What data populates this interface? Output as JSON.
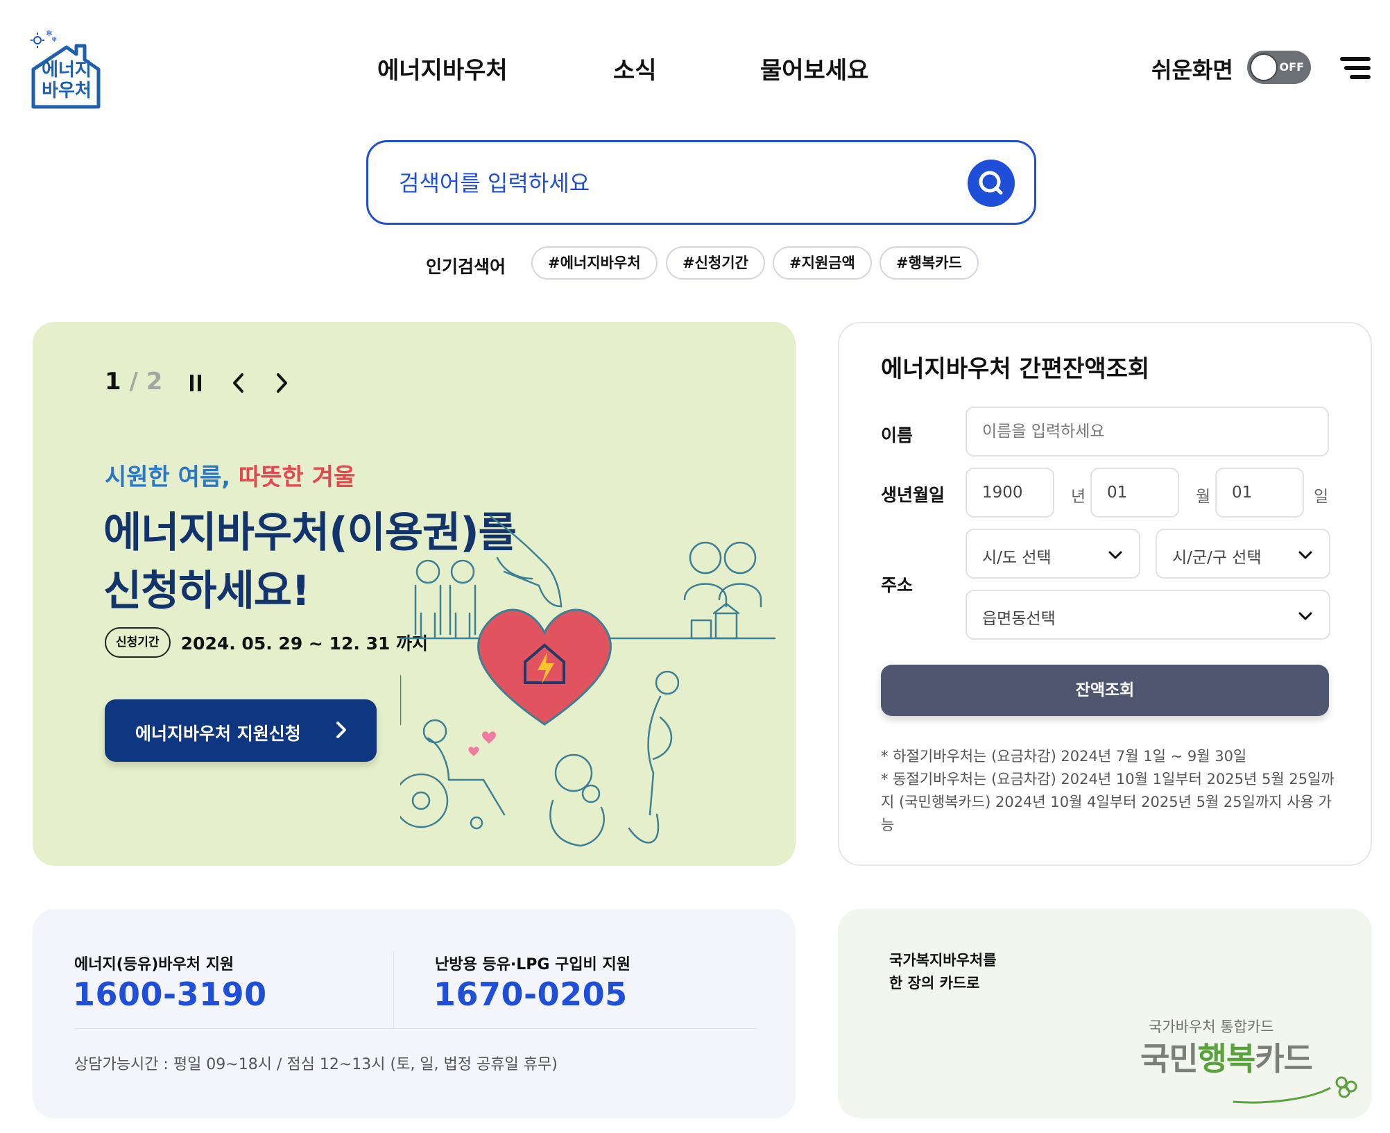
{
  "header": {
    "logo_text_line1": "에너지",
    "logo_text_line2": "바우처",
    "nav": [
      "에너지바우처",
      "소식",
      "물어보세요"
    ],
    "easy_screen_label": "쉬운화면",
    "toggle_state": "OFF",
    "menu_icon": "hamburger-menu-icon"
  },
  "search": {
    "placeholder": "검색어를 입력하세요",
    "button_icon": "search-icon",
    "popular_label": "인기검색어",
    "popular_tags": [
      "#에너지바우처",
      "#신청기간",
      "#지원금액",
      "#행복카드"
    ]
  },
  "banner": {
    "page_current": "1",
    "page_separator": "/",
    "page_total": "2",
    "subtitle_a": "시원한 여름,",
    "subtitle_b": "따뜻한 겨울",
    "headline_line1": "에너지바우처(이용권)를",
    "headline_line2": "신청하세요!",
    "period_badge": "신청기간",
    "period_text": "2024. 05. 29 ~ 12. 31 까지",
    "apply_button": "에너지바우처 지원신청",
    "controls": [
      "pause-icon",
      "chevron-left-icon",
      "chevron-right-icon"
    ],
    "background_color": "#e6efcb"
  },
  "balance": {
    "title": "에너지바우처 간편잔액조회",
    "name_label": "이름",
    "name_placeholder": "이름을 입력하세요",
    "birth_label": "생년월일",
    "birth_year": "1900",
    "birth_year_unit": "년",
    "birth_month": "01",
    "birth_month_unit": "월",
    "birth_day": "01",
    "birth_day_unit": "일",
    "address_label": "주소",
    "sido_select": "시/도 선택",
    "sigungu_select": "시/군/구 선택",
    "eup_select": "읍면동선택",
    "submit_button": "잔액조회",
    "note1": "* 하절기바우처는 (요금차감) 2024년 7월 1일 ~ 9월 30일",
    "note2": "* 동절기바우처는 (요금차감) 2024년 10월 1일부터 2025년 5월 25일까지 (국민행복카드) 2024년 10월 4일부터 2025년 5월 25일까지 사용 가능"
  },
  "contact": {
    "label1": "에너지(등유)바우처 지원",
    "number1": "1600-3190",
    "label2": "난방용 등유·LPG 구입비 지원",
    "number2": "1670-0205",
    "hours": "상담가능시간 : 평일 09~18시 / 점심 12~13시 (토, 일, 법정 공휴일 휴무)"
  },
  "card": {
    "text_line1": "국가복지바우처를",
    "text_line2": "한 장의 카드로",
    "sub": "국가바우처 통합카드",
    "logo_a": "국민",
    "logo_b": "행복",
    "logo_c": "카드"
  },
  "colors": {
    "accent_blue": "#1f4fd8",
    "navy": "#0f3680",
    "button_gray": "#4e5670"
  }
}
